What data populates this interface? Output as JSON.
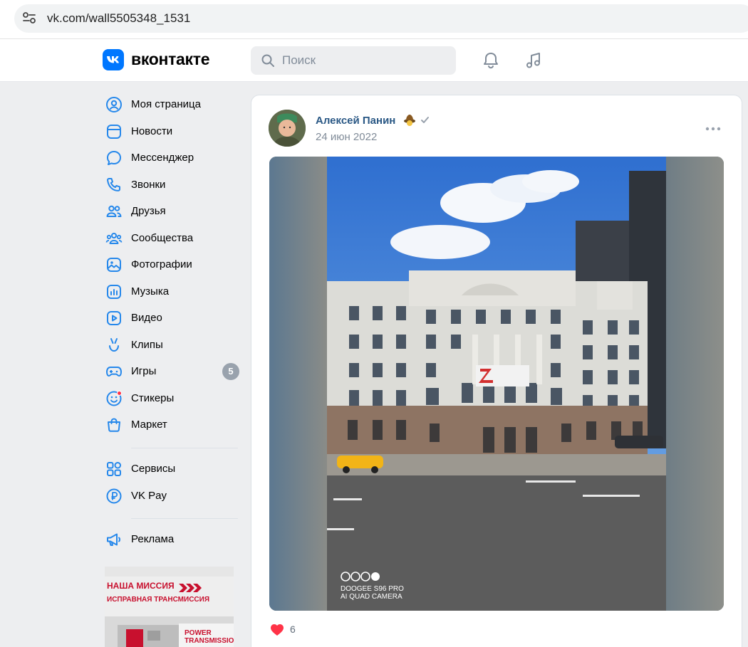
{
  "browser": {
    "url": "vk.com/wall5505348_1531"
  },
  "header": {
    "logo_text": "вконтакте",
    "search_placeholder": "Поиск"
  },
  "sidebar": {
    "items": [
      {
        "label": "Моя страница",
        "icon": "profile-icon"
      },
      {
        "label": "Новости",
        "icon": "news-icon"
      },
      {
        "label": "Мессенджер",
        "icon": "messenger-icon"
      },
      {
        "label": "Звонки",
        "icon": "phone-icon"
      },
      {
        "label": "Друзья",
        "icon": "friends-icon"
      },
      {
        "label": "Сообщества",
        "icon": "communities-icon"
      },
      {
        "label": "Фотографии",
        "icon": "photos-icon"
      },
      {
        "label": "Музыка",
        "icon": "music-icon"
      },
      {
        "label": "Видео",
        "icon": "video-icon"
      },
      {
        "label": "Клипы",
        "icon": "clips-icon"
      },
      {
        "label": "Игры",
        "icon": "games-icon",
        "badge": "5"
      },
      {
        "label": "Стикеры",
        "icon": "stickers-icon"
      },
      {
        "label": "Маркет",
        "icon": "market-icon"
      },
      {
        "label": "Сервисы",
        "icon": "services-icon"
      },
      {
        "label": "VK Pay",
        "icon": "vkpay-icon"
      },
      {
        "label": "Реклама",
        "icon": "ads-icon"
      }
    ],
    "ad": {
      "line1": "НАША МИССИЯ",
      "line2": "ИСПРАВНАЯ ТРАНСМИССИЯ",
      "line3a": "POWER",
      "line3b": "TRANSMISSIO"
    }
  },
  "post": {
    "author": "Алексей Панин",
    "date": "24 июн 2022",
    "photo_caption_line1": "DOOGEE S96 PRO",
    "photo_caption_line2": "AI QUAD CAMERA",
    "likes": "6"
  },
  "colors": {
    "accent": "#0077ff",
    "link": "#2a5885",
    "like": "#ff3347",
    "muted": "#818c99"
  }
}
